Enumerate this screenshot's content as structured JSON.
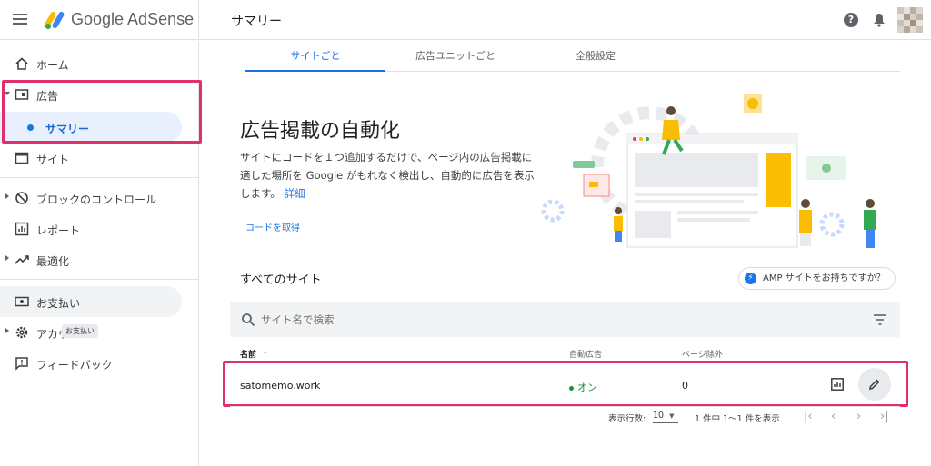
{
  "header": {
    "brand": "Google AdSense",
    "page_title": "サマリー"
  },
  "sidebar": {
    "items": [
      {
        "label": "ホーム"
      },
      {
        "label": "広告"
      },
      {
        "label": "サマリー"
      },
      {
        "label": "サイト"
      },
      {
        "label": "ブロックのコントロール"
      },
      {
        "label": "レポート"
      },
      {
        "label": "最適化"
      },
      {
        "label": "お支払い"
      },
      {
        "label": "アカウ"
      },
      {
        "label": "フィードバック"
      }
    ],
    "tooltip": "お支払い"
  },
  "tabs": [
    {
      "label": "サイトごと"
    },
    {
      "label": "広告ユニットごと"
    },
    {
      "label": "全般設定"
    }
  ],
  "hero": {
    "title": "広告掲載の自動化",
    "description": "サイトにコードを１つ追加するだけで、ページ内の広告掲載に適した場所を Google がもれなく検出し、自動的に広告を表示します。",
    "details_link": "詳細",
    "get_code": "コードを取得"
  },
  "sites": {
    "title": "すべてのサイト",
    "amp_button": "AMP サイトをお持ちですか？",
    "search_placeholder": "サイト名で検索",
    "columns": {
      "name": "名前",
      "auto_ads": "自動広告",
      "page_exclusions": "ページ除外"
    },
    "rows": [
      {
        "name": "satomemo.work",
        "auto_ads": "オン",
        "page_exclusions": "0"
      }
    ]
  },
  "pagination": {
    "rows_per_page_label": "表示行数:",
    "rows_per_page": "10",
    "range": "1 件中 1〜1 件を表示"
  },
  "colors": {
    "accent": "#1a73e8",
    "highlight": "#e0306a",
    "status_on": "#1e8e3e"
  }
}
